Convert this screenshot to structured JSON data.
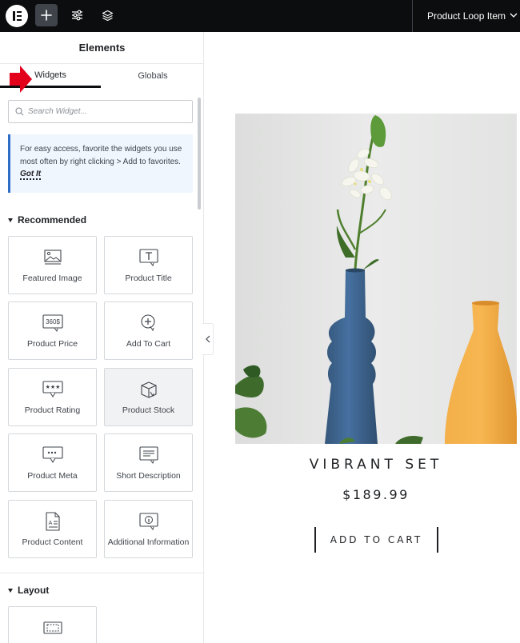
{
  "topbar": {
    "context_title": "Product Loop Item"
  },
  "sidebar": {
    "title": "Elements",
    "tabs": [
      {
        "label": "Widgets",
        "active": true
      },
      {
        "label": "Globals",
        "active": false
      }
    ],
    "search": {
      "placeholder": "Search Widget...",
      "value": ""
    },
    "notice": {
      "text": "For easy access, favorite the widgets you use most often by right clicking > Add to favorites.",
      "action": "Got It"
    },
    "sections": [
      {
        "title": "Recommended",
        "widgets": [
          {
            "label": "Featured Image",
            "icon": "featured-image-icon"
          },
          {
            "label": "Product Title",
            "icon": "product-title-icon"
          },
          {
            "label": "Product Price",
            "icon": "product-price-icon",
            "icon_text": "360$"
          },
          {
            "label": "Add To Cart",
            "icon": "add-to-cart-icon"
          },
          {
            "label": "Product Rating",
            "icon": "product-rating-icon"
          },
          {
            "label": "Product Stock",
            "icon": "product-stock-icon"
          },
          {
            "label": "Product Meta",
            "icon": "product-meta-icon"
          },
          {
            "label": "Short Description",
            "icon": "short-description-icon"
          },
          {
            "label": "Product Content",
            "icon": "product-content-icon"
          },
          {
            "label": "Additional Information",
            "icon": "additional-information-icon"
          }
        ]
      },
      {
        "title": "Layout",
        "widgets": [
          {
            "label": "",
            "icon": "container-icon"
          }
        ]
      }
    ]
  },
  "product": {
    "name": "VIBRANT SET",
    "price": "$189.99",
    "button_label": "ADD TO CART"
  },
  "colors": {
    "topbar": "#0c0d0e",
    "notice_bg": "#eff6fe",
    "notice_border": "#2e6ec8",
    "arrow": "#e3001b",
    "vase_blue": "#3e6386",
    "vase_orange": "#f2a43a"
  }
}
